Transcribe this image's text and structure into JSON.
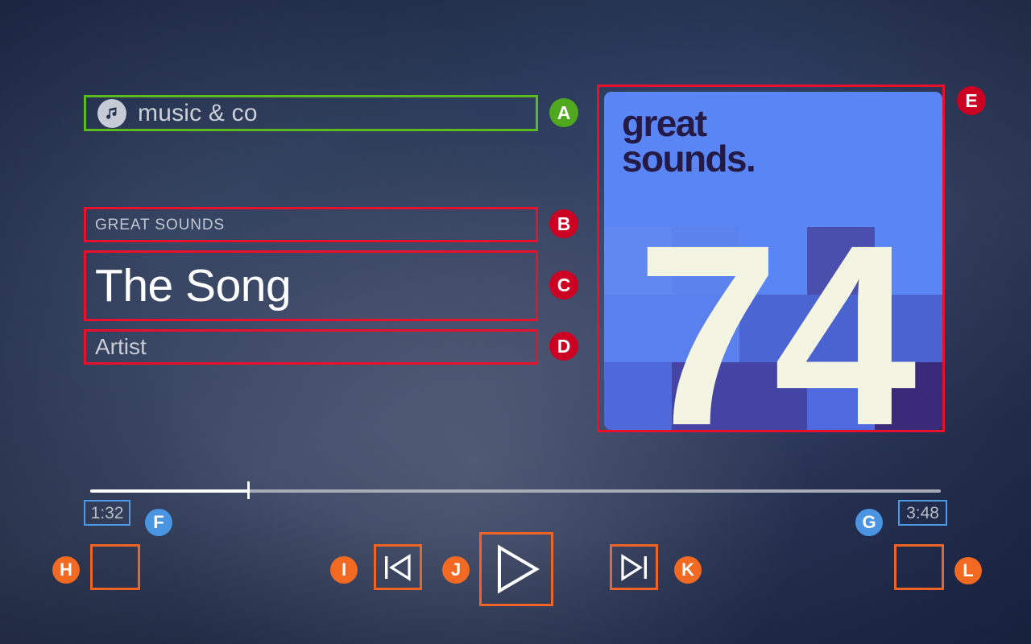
{
  "app": {
    "name": "music & co",
    "icon": "music-note-icon"
  },
  "track": {
    "album": "GREAT SOUNDS",
    "title": "The Song",
    "artist": "Artist"
  },
  "album_art": {
    "wordmark_line1": "great",
    "wordmark_line2": "sounds.",
    "number": "74",
    "bg_color": "#5a85f5",
    "text_color": "#251a46",
    "number_color": "#f4f4e2"
  },
  "player": {
    "elapsed": "1:32",
    "total": "3:48",
    "progress_percent": 18.6,
    "controls": {
      "shuffle_label": "",
      "previous_label": "previous-track",
      "play_label": "play",
      "next_label": "next-track",
      "repeat_label": ""
    }
  },
  "annotations": [
    {
      "id": "A",
      "target": "app-name-field",
      "color": "#4fa81d"
    },
    {
      "id": "B",
      "target": "album-name-field",
      "color": "#cc0022"
    },
    {
      "id": "C",
      "target": "song-title-field",
      "color": "#cc0022"
    },
    {
      "id": "D",
      "target": "artist-name-field",
      "color": "#cc0022"
    },
    {
      "id": "E",
      "target": "album-artwork",
      "color": "#cc0022"
    },
    {
      "id": "F",
      "target": "elapsed-time",
      "color": "#4a95e2"
    },
    {
      "id": "G",
      "target": "total-time",
      "color": "#4a95e2"
    },
    {
      "id": "H",
      "target": "shuffle-button",
      "color": "#f26a22"
    },
    {
      "id": "I",
      "target": "previous-button",
      "color": "#f26a22"
    },
    {
      "id": "J",
      "target": "play-button",
      "color": "#f26a22"
    },
    {
      "id": "K",
      "target": "next-button",
      "color": "#f26a22"
    },
    {
      "id": "L",
      "target": "repeat-button",
      "color": "#f26a22"
    }
  ]
}
